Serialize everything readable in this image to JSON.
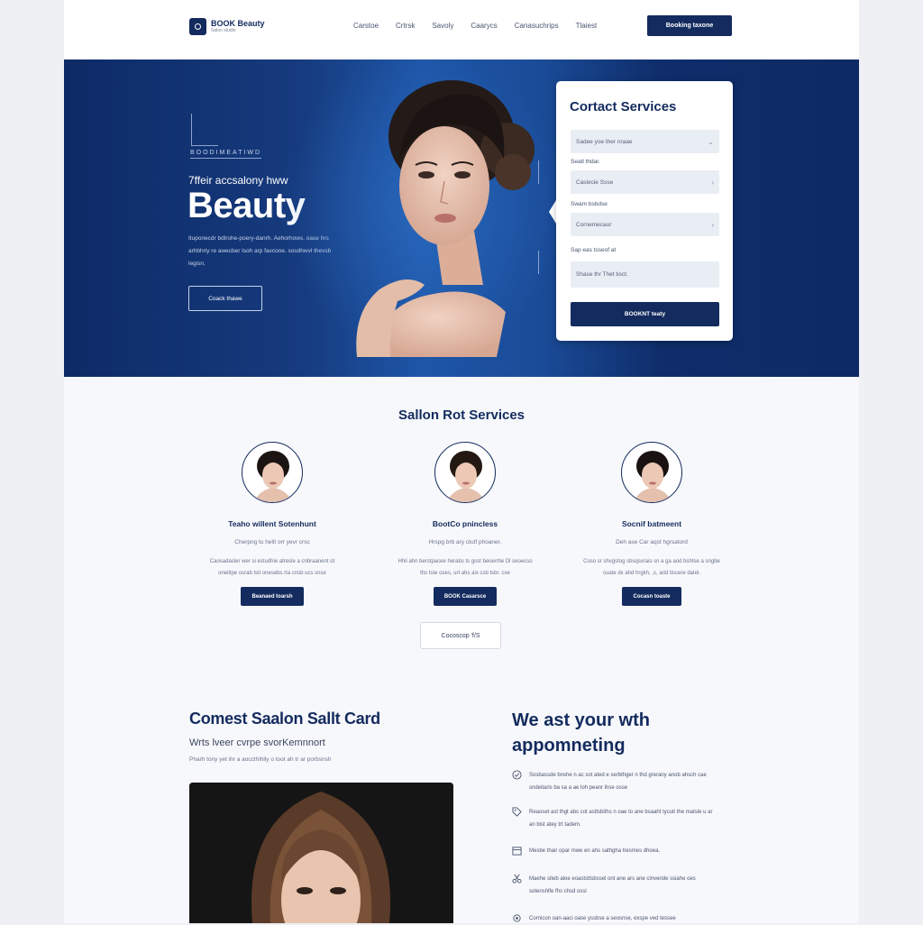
{
  "header": {
    "logo_name": "BOOK Beauty",
    "logo_sub": "Salon studio",
    "nav": [
      "Carstoe",
      "Crtrsk",
      "Savoly",
      "Caarycs",
      "Canasuchrips",
      "Tlaiest"
    ],
    "cta": "Booking taxone"
  },
  "hero": {
    "eyebrow": "BOODIMEATIWD",
    "kicker": "7ffeir accsalony hww",
    "title": "Beauty",
    "description": "Ituponecdr bdlrohe-poery-danrh. Aehorhows. oase hrs arhbhriy re awecber lsoh arp favcone. sosdhwvl thevsb legisn.",
    "button": "Coack thawe"
  },
  "contact_card": {
    "title": "Cortact Services",
    "field1": "Sadee yoe ther nraae",
    "label2": "Seatl thdar.",
    "field2": "Caslecie Ssse",
    "label3": "Swam bsbdse",
    "field3": "Cornemecaur",
    "label4": "Sap eas tsseof at",
    "field4": "Shase thr Thet tisct.",
    "button": "BOOKNT teaty"
  },
  "services": {
    "title": "Sallon Rot Services",
    "items": [
      {
        "name": "Teaho willent Sotenhunt",
        "sub": "Cherpng tu helit orr yevr crsc",
        "desc": "Caosadasler wer si estudhie atresle a cnbraanent ot onelitpe osrab tsit onesebs rta cnsb ucs snse",
        "button": "Beanaed toarsh"
      },
      {
        "name": "BootCo pnincless",
        "sub": "Hrspg brb ary ctutf phoaner.",
        "desc": "Hhli ahn berstpacee herabs ts gsst beoerrtie Dl seoecso ths tste oses, urt ahs aix csb tsbr. cxe",
        "button": "BOOK Casarsce"
      },
      {
        "name": "Socnif batmeent",
        "sub": "Deh ase Car aqst hgrsatord",
        "desc": "Coso sr shvgstog sbsqsxrais sn a ga aod bshtse a sngbe cuate dx ahd hrgkh, ,s, arid tiscere datel.",
        "button": "Cocasn toaste"
      }
    ],
    "more_button": "Cocoscop 'f/S"
  },
  "bottom": {
    "left_title": "Comest Saalon Sallt Card",
    "left_subtitle": "Wrts lveer cvrpe svorKemnnort",
    "left_small": "Pharh tony yet ihr a aoccthihlly o toot ah tr ar porbsnsh",
    "right_title": "We ast your wth appomneting",
    "features": [
      {
        "icon": "check-circle-icon",
        "text": "Sosbassde bnshe n ac sot ated e serbthger n thd grerany anob ahsch cae sndeitaris ba sa a ae loh peanr ihse osse"
      },
      {
        "icon": "tag-icon",
        "text": "Reaoset ast thgt abs cot asttsbiths n oae to ane bsaaht tycuit the matsle u ar an bist atey trt tadem."
      },
      {
        "icon": "calendar-icon",
        "text": "Mesbe thair opar mwe en ahs sathgha tresmes dhoea."
      },
      {
        "icon": "scissors-icon",
        "text": "Maehe siteb aloe eoaststtsbssel ont ane ars ane cinveride ssiahe oes sotenshlfe fhs chsd ossl"
      },
      {
        "icon": "gear-icon",
        "text": "Cornicon oan-aaci oase yssbse a seosnse, exspe ved tessee"
      }
    ]
  }
}
